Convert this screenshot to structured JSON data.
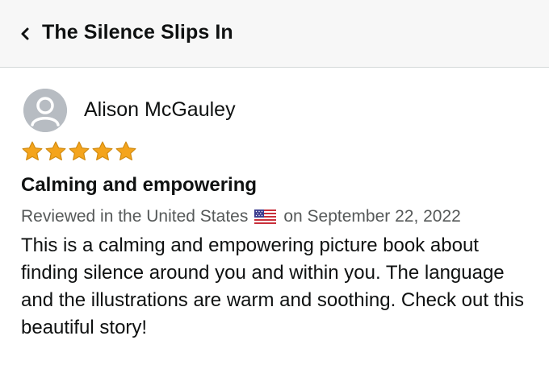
{
  "header": {
    "title": "The Silence Slips In",
    "back_icon": "chevron-left-icon"
  },
  "review": {
    "reviewer_name": "Alison McGauley",
    "avatar_icon": "user-avatar-icon",
    "rating": 5,
    "rating_max": 5,
    "star_color": "#f4a41c",
    "title": "Calming and empowering",
    "meta_prefix": "Reviewed in the United States",
    "flag_icon": "us-flag-icon",
    "meta_suffix": "on September 22, 2022",
    "body": "This is a calming and empowering picture book about finding silence around you and within you. The language and the illustrations are warm and soothing. Check out this beautiful story!"
  }
}
